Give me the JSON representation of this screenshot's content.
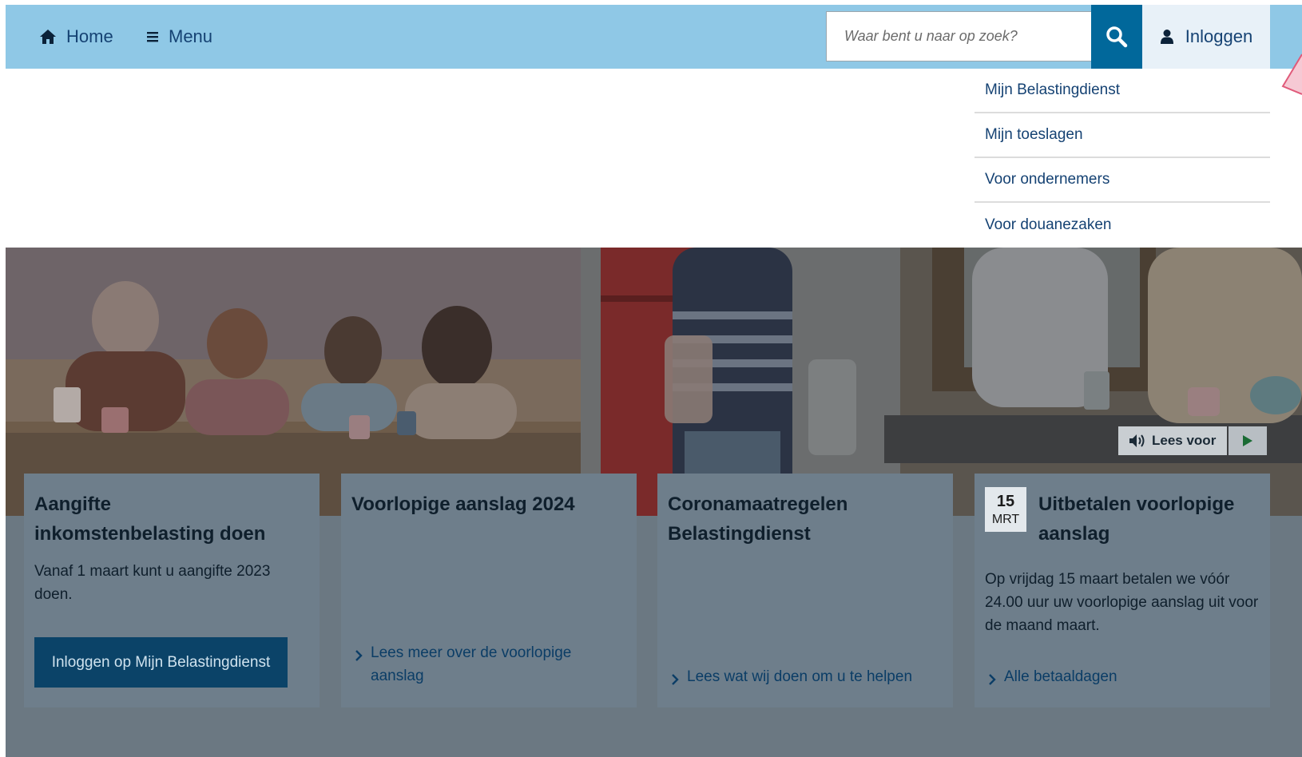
{
  "header": {
    "home_label": "Home",
    "menu_label": "Menu",
    "search_placeholder": "Waar bent u naar op zoek?",
    "login_label": "Inloggen"
  },
  "login_dropdown": {
    "items": [
      {
        "label": "Mijn Belastingdienst"
      },
      {
        "label": "Mijn toeslagen"
      },
      {
        "label": "Voor ondernemers"
      },
      {
        "label": "Voor douanezaken"
      }
    ]
  },
  "read_aloud": {
    "label": "Lees voor"
  },
  "cards": [
    {
      "title_line1": "Aangifte",
      "title_line2": "inkomstenbelasting doen",
      "text": "Vanaf 1 maart kunt u aangifte 2023 doen.",
      "button_label": "Inloggen op Mijn Belastingdienst"
    },
    {
      "title": "Voorlopige aanslag 2024",
      "link_label": "Lees meer over de voorlopige aanslag"
    },
    {
      "title_line1": "Coronamaatregelen",
      "title_line2": "Belastingdienst",
      "link_label": "Lees wat wij doen om u te helpen"
    },
    {
      "date_day": "15",
      "date_month": "MRT",
      "title_line1": "Uitbetalen voorlopige",
      "title_line2": "aanslag",
      "text": "Op vrijdag 15 maart betalen we vóór 24.00 uur uw voorlopige aanslag uit voor de maand maart.",
      "link_label": "Alle betaaldagen"
    }
  ],
  "colors": {
    "topbar": "#8fc8e6",
    "search_button": "#01689b",
    "primary_button": "#0b4368",
    "card_background": "#6e7e8b",
    "link": "#0b3d66"
  },
  "icons": [
    "home-icon",
    "menu-icon",
    "search-icon",
    "user-icon",
    "speaker-icon",
    "play-icon",
    "chevron-right-icon"
  ]
}
